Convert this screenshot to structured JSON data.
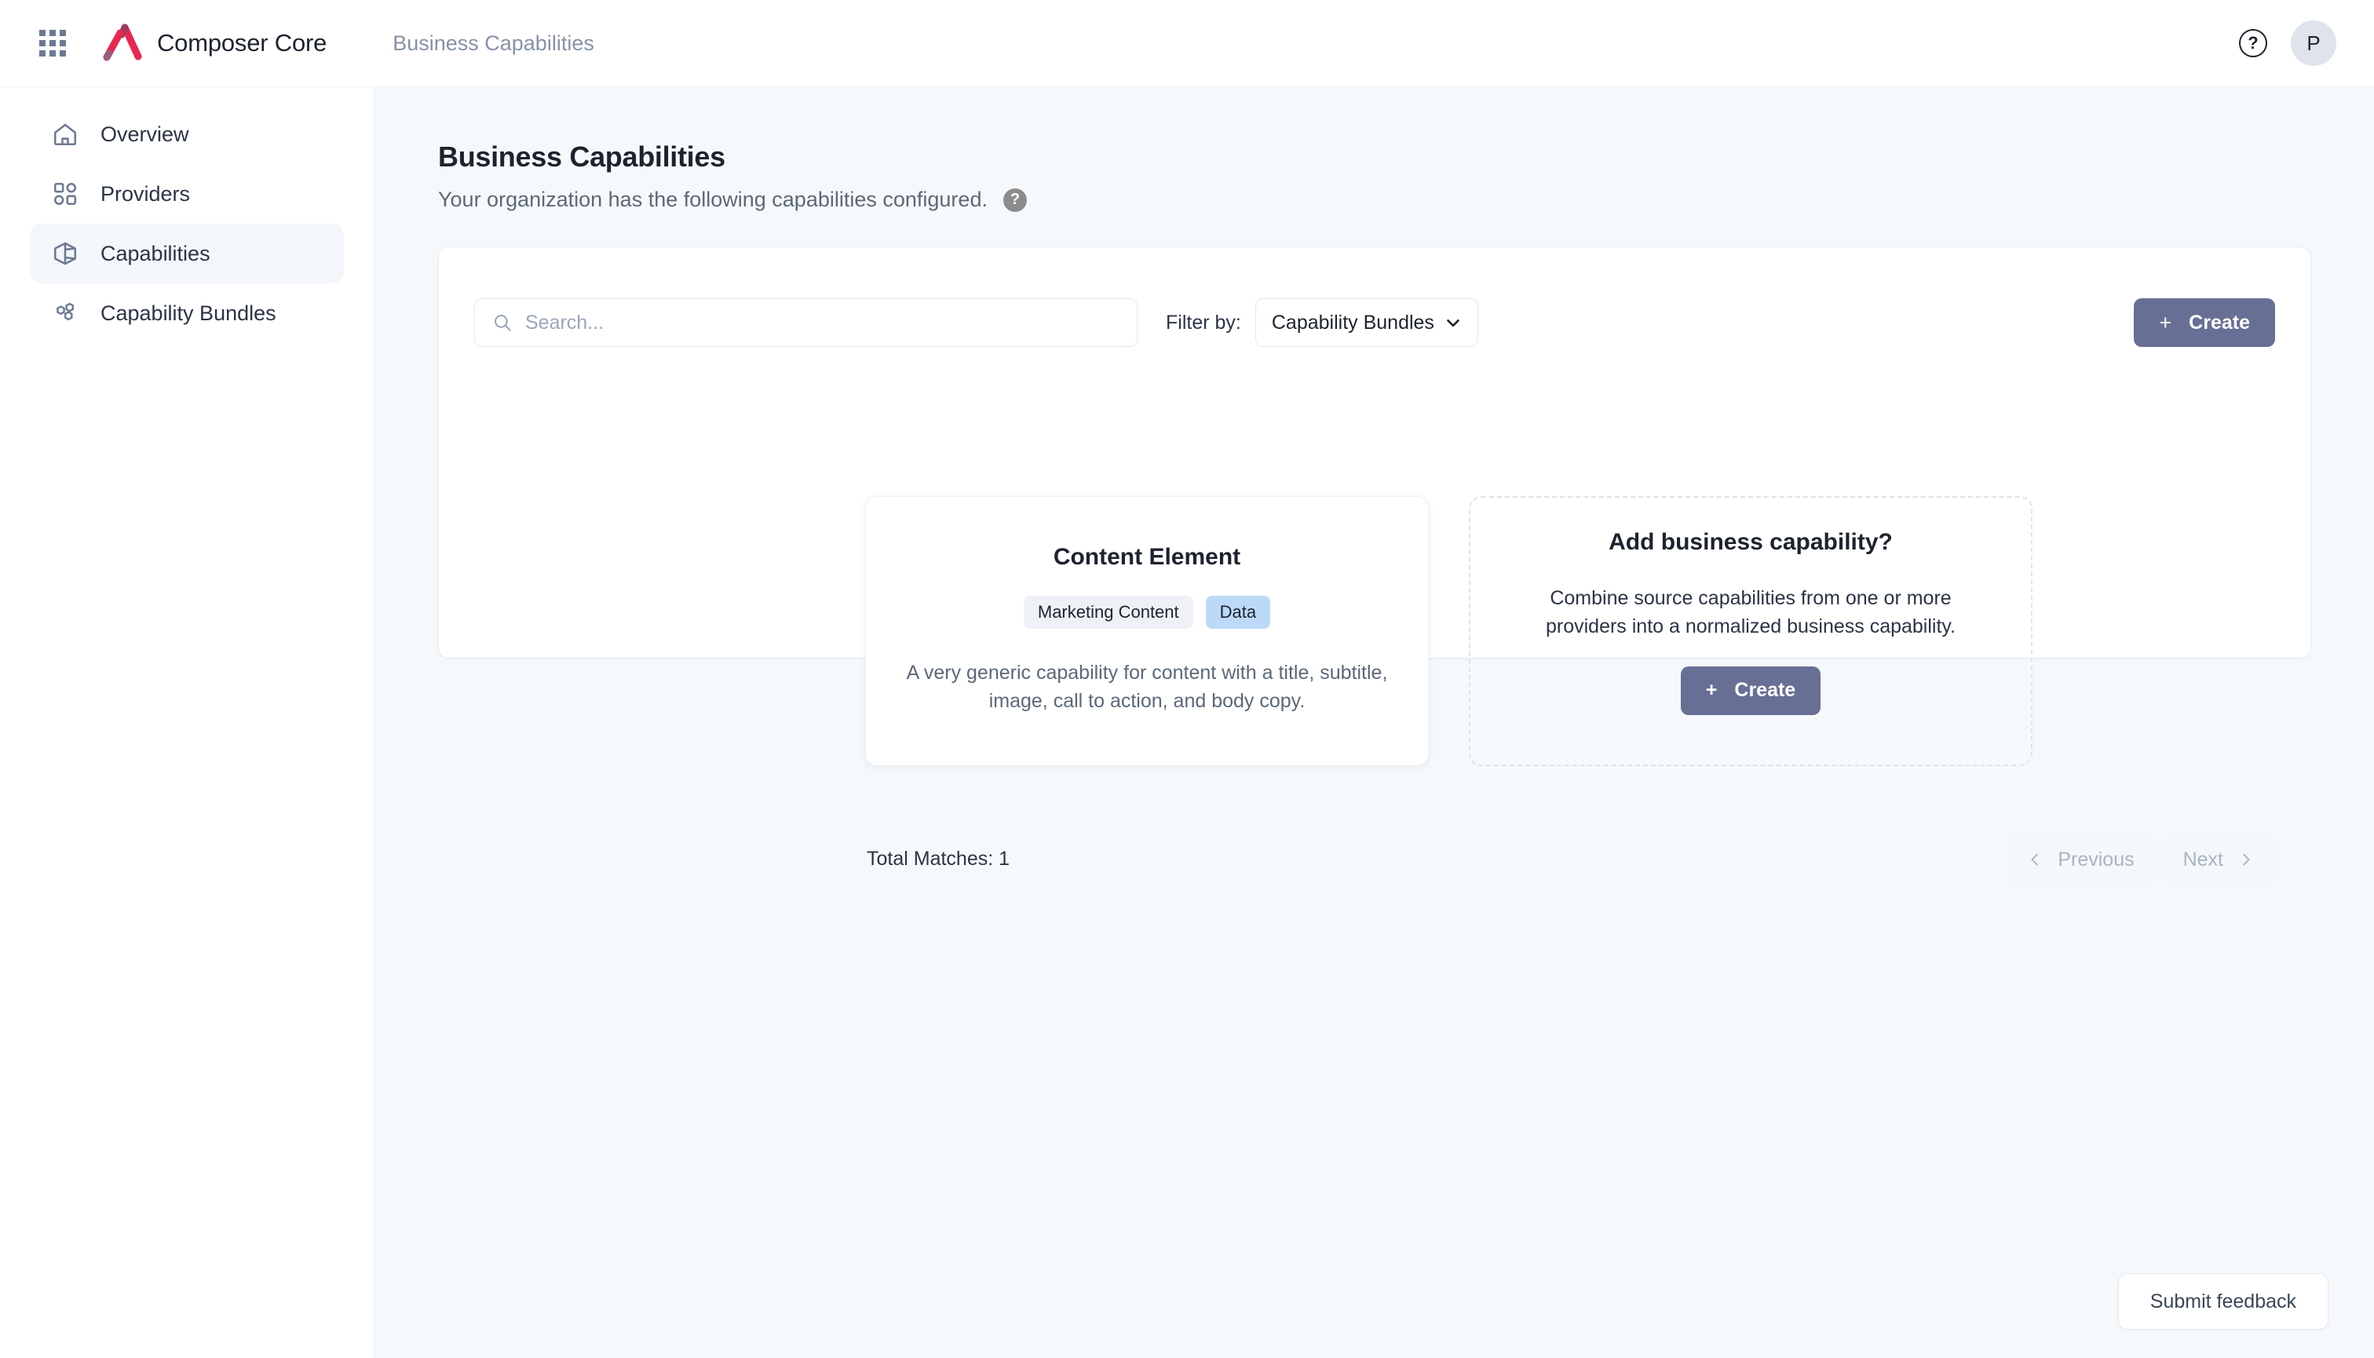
{
  "topbar": {
    "apps_icon": "apps-grid-icon",
    "brand_name": "Composer Core",
    "breadcrumb": "Business Capabilities",
    "help_glyph": "?",
    "avatar_initial": "P"
  },
  "sidebar": {
    "items": [
      {
        "label": "Overview",
        "icon": "home-icon",
        "active": false
      },
      {
        "label": "Providers",
        "icon": "providers-icon",
        "active": false
      },
      {
        "label": "Capabilities",
        "icon": "cube-icon",
        "active": true
      },
      {
        "label": "Capability Bundles",
        "icon": "hexagons-icon",
        "active": false
      }
    ]
  },
  "page": {
    "title": "Business Capabilities",
    "subtitle": "Your organization has the following capabilities configured.",
    "help_glyph": "?"
  },
  "toolbar": {
    "search_placeholder": "Search...",
    "search_value": "",
    "filter_label": "Filter by:",
    "filter_selected": "Capability Bundles",
    "filter_options": [
      "Capability Bundles"
    ],
    "create_label": "Create",
    "create_plus": "+"
  },
  "capability_card": {
    "title": "Content Element",
    "tags": [
      {
        "label": "Marketing Content",
        "style": "grey"
      },
      {
        "label": "Data",
        "style": "blue"
      }
    ],
    "description": "A very generic capability for content with a title, subtitle, image, call to action, and body copy."
  },
  "add_card": {
    "title": "Add business capability?",
    "description": "Combine source capabilities from one or more providers into a normalized business capability.",
    "create_label": "Create",
    "create_plus": "+"
  },
  "footer": {
    "total_matches": "Total Matches: 1",
    "previous_label": "Previous",
    "next_label": "Next"
  },
  "feedback": {
    "label": "Submit feedback"
  },
  "colors": {
    "accent_button": "#676f94",
    "brand_red": "#e8264f",
    "brand_plum": "#9b5d7e",
    "tag_blue": "#bcd9f8",
    "canvas": "#f6f9fc"
  }
}
